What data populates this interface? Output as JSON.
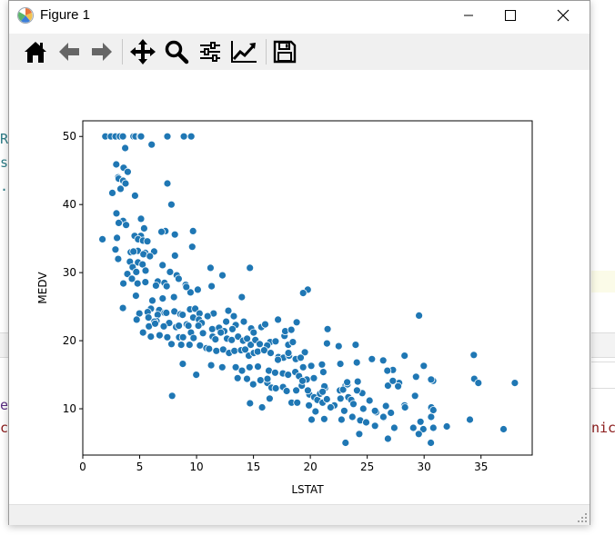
{
  "window": {
    "title": "Figure 1",
    "controls": {
      "minimize": "minimize",
      "maximize": "maximize",
      "close": "close"
    }
  },
  "toolbar": {
    "buttons": [
      {
        "icon": "home-icon",
        "name": "home-button"
      },
      {
        "icon": "back-arrow-icon",
        "name": "back-button"
      },
      {
        "icon": "forward-arrow-icon",
        "name": "forward-button"
      },
      {
        "icon": "pan-icon",
        "name": "pan-button"
      },
      {
        "icon": "zoom-icon",
        "name": "zoom-button"
      },
      {
        "icon": "configure-subplots-icon",
        "name": "subplots-button"
      },
      {
        "icon": "edit-axis-icon",
        "name": "edit-axis-button"
      },
      {
        "icon": "save-icon",
        "name": "save-button"
      }
    ]
  },
  "background": {
    "left_fragments": [
      "R",
      "s",
      "."
    ],
    "left_bottom_fragments": [
      "ex",
      "cu"
    ],
    "right_fragment": "nic",
    "colors": {
      "teal": "#2e7d87",
      "dark_red": "#8b1a1a",
      "purple": "#5a2d82"
    }
  },
  "chart_data": {
    "type": "scatter",
    "xlabel": "LSTAT",
    "ylabel": "MEDV",
    "xlim": [
      0,
      39.5
    ],
    "ylim": [
      3.2,
      52.3
    ],
    "xticks": [
      0,
      5,
      10,
      15,
      20,
      25,
      30,
      35
    ],
    "yticks": [
      10,
      20,
      30,
      40,
      50
    ],
    "grid": false,
    "marker_color": "#1f77b4",
    "marker_edge": "#ffffff",
    "points": [
      [
        1.98,
        50
      ],
      [
        2.47,
        50
      ],
      [
        2.88,
        50
      ],
      [
        3.26,
        50
      ],
      [
        3.53,
        50
      ],
      [
        4.45,
        50
      ],
      [
        4.63,
        50
      ],
      [
        5.04,
        50
      ],
      [
        5.12,
        50
      ],
      [
        7.44,
        50
      ],
      [
        8.88,
        50
      ],
      [
        9.53,
        50
      ],
      [
        6.05,
        48.8
      ],
      [
        3.73,
        48.3
      ],
      [
        2.94,
        45.9
      ],
      [
        3.59,
        45.4
      ],
      [
        3.95,
        44.8
      ],
      [
        3.11,
        44
      ],
      [
        3.16,
        43.8
      ],
      [
        3.55,
        43.5
      ],
      [
        3.76,
        43.1
      ],
      [
        7.44,
        43.1
      ],
      [
        3.32,
        42.3
      ],
      [
        2.6,
        41.7
      ],
      [
        4.59,
        41.3
      ],
      [
        7.79,
        40
      ],
      [
        2.96,
        38.7
      ],
      [
        5.12,
        37.9
      ],
      [
        3.54,
        37.6
      ],
      [
        3.16,
        37.3
      ],
      [
        3.81,
        37
      ],
      [
        5.39,
        36.5
      ],
      [
        7.26,
        36.1
      ],
      [
        9.69,
        36.1
      ],
      [
        6.92,
        36
      ],
      [
        8.09,
        35.6
      ],
      [
        5.1,
        35.4
      ],
      [
        4.56,
        35.4
      ],
      [
        3.01,
        35.1
      ],
      [
        1.73,
        34.9
      ],
      [
        4.86,
        34.9
      ],
      [
        5.29,
        34.7
      ],
      [
        5.68,
        34.6
      ],
      [
        9.62,
        33.8
      ],
      [
        2.87,
        33.4
      ],
      [
        4.84,
        33.2
      ],
      [
        4.21,
        33
      ],
      [
        4.45,
        33.1
      ],
      [
        6.27,
        33.1
      ],
      [
        5.49,
        32.9
      ],
      [
        5.33,
        32.7
      ],
      [
        8.1,
        32.5
      ],
      [
        5.9,
        32.4
      ],
      [
        3.11,
        32
      ],
      [
        4.14,
        31.6
      ],
      [
        4.85,
        31.5
      ],
      [
        5.25,
        31.2
      ],
      [
        7.01,
        31.1
      ],
      [
        4.38,
        30.8
      ],
      [
        11.23,
        30.7
      ],
      [
        14.69,
        30.7
      ],
      [
        5.52,
        30.3
      ],
      [
        4.7,
        30.1
      ],
      [
        7.67,
        30.1
      ],
      [
        3.92,
        29.8
      ],
      [
        8.26,
        29.6
      ],
      [
        12.27,
        29.6
      ],
      [
        8.43,
        29.1
      ],
      [
        4.32,
        29.1
      ],
      [
        6.59,
        28.7
      ],
      [
        5.5,
        28.6
      ],
      [
        7.18,
        28.5
      ],
      [
        4.81,
        28.4
      ],
      [
        9.04,
        28.2
      ],
      [
        3.57,
        28.4
      ],
      [
        6.43,
        28.1
      ],
      [
        7.37,
        28
      ],
      [
        11.32,
        28
      ],
      [
        10.11,
        27.5
      ],
      [
        9.47,
        27.1
      ],
      [
        9.1,
        27.9
      ],
      [
        19.77,
        27.5
      ],
      [
        19.37,
        27
      ],
      [
        4.67,
        26.6
      ],
      [
        7.02,
        26.2
      ],
      [
        8.01,
        26.4
      ],
      [
        13.98,
        26.4
      ],
      [
        6.12,
        25.9
      ],
      [
        5.99,
        24.7
      ],
      [
        6.72,
        24.5
      ],
      [
        5.7,
        24.2
      ],
      [
        7.19,
        24.1
      ],
      [
        4.97,
        24
      ],
      [
        3.53,
        24.8
      ],
      [
        8.05,
        24.3
      ],
      [
        7.34,
        24.1
      ],
      [
        8.58,
        23.9
      ],
      [
        6.58,
        23.8
      ],
      [
        9.43,
        24.6
      ],
      [
        9.88,
        24.7
      ],
      [
        10.26,
        24
      ],
      [
        8.77,
        23.8
      ],
      [
        5.77,
        23.4
      ],
      [
        6.48,
        22.9
      ],
      [
        9.71,
        23.4
      ],
      [
        10.21,
        23.1
      ],
      [
        7.6,
        22.6
      ],
      [
        6.29,
        22.8
      ],
      [
        10.45,
        22.6
      ],
      [
        11.5,
        24
      ],
      [
        12.79,
        24.4
      ],
      [
        13.27,
        23.6
      ],
      [
        10.97,
        23.6
      ],
      [
        4.73,
        23.1
      ],
      [
        5.81,
        22.1
      ],
      [
        6.36,
        22.5
      ],
      [
        7.12,
        22.1
      ],
      [
        8.2,
        22
      ],
      [
        9.14,
        22.4
      ],
      [
        8.44,
        22.2
      ],
      [
        9.28,
        22.2
      ],
      [
        10.16,
        22.2
      ],
      [
        11.38,
        21.7
      ],
      [
        11.98,
        21.9
      ],
      [
        12.6,
        22.8
      ],
      [
        13.44,
        22.3
      ],
      [
        12.43,
        21.4
      ],
      [
        13.15,
        21.7
      ],
      [
        14.15,
        22.8
      ],
      [
        14.8,
        21.8
      ],
      [
        15.02,
        21.2
      ],
      [
        15.7,
        22
      ],
      [
        16.03,
        22.4
      ],
      [
        16.47,
        19.8
      ],
      [
        17.16,
        23.1
      ],
      [
        5.29,
        21.2
      ],
      [
        5.98,
        20.6
      ],
      [
        6.75,
        20.8
      ],
      [
        7.43,
        20.5
      ],
      [
        8.47,
        20.5
      ],
      [
        8.81,
        20.5
      ],
      [
        9.51,
        21.2
      ],
      [
        9.74,
        20.4
      ],
      [
        10.56,
        21.1
      ],
      [
        11.41,
        20.6
      ],
      [
        11.66,
        20.2
      ],
      [
        12.13,
        21.2
      ],
      [
        12.67,
        20.3
      ],
      [
        13.09,
        20.1
      ],
      [
        13.65,
        20.6
      ],
      [
        14.09,
        20
      ],
      [
        14.44,
        20.3
      ],
      [
        14.76,
        19.4
      ],
      [
        15.17,
        20.1
      ],
      [
        15.55,
        19.5
      ],
      [
        16.21,
        19.3
      ],
      [
        16.94,
        19.9
      ],
      [
        17.73,
        20.7
      ],
      [
        18.06,
        19.4
      ],
      [
        18.46,
        19.8
      ],
      [
        19.52,
        18.3
      ],
      [
        7.8,
        19.5
      ],
      [
        8.65,
        19.4
      ],
      [
        9.38,
        19.4
      ],
      [
        10.3,
        19.3
      ],
      [
        10.87,
        18.9
      ],
      [
        11.1,
        18.8
      ],
      [
        11.74,
        18.5
      ],
      [
        12.34,
        18.7
      ],
      [
        12.86,
        18.2
      ],
      [
        13.33,
        18.5
      ],
      [
        13.91,
        18.6
      ],
      [
        14.27,
        18.7
      ],
      [
        14.59,
        17.8
      ],
      [
        15.03,
        18.2
      ],
      [
        15.37,
        18.4
      ],
      [
        15.94,
        18.6
      ],
      [
        16.51,
        18.2
      ],
      [
        17.19,
        17.6
      ],
      [
        17.64,
        17.5
      ],
      [
        18.13,
        17.8
      ],
      [
        18.72,
        17.3
      ],
      [
        19.15,
        17.5
      ],
      [
        8.79,
        16.6
      ],
      [
        11.28,
        16.4
      ],
      [
        12.26,
        16.1
      ],
      [
        13.44,
        16.1
      ],
      [
        13.99,
        15.6
      ],
      [
        14.66,
        16.1
      ],
      [
        15.39,
        16.2
      ],
      [
        16.35,
        15.6
      ],
      [
        16.9,
        15.3
      ],
      [
        17.58,
        15.2
      ],
      [
        18.05,
        15
      ],
      [
        18.68,
        15.4
      ],
      [
        19.01,
        14.8
      ],
      [
        19.69,
        14.3
      ],
      [
        20.31,
        14.5
      ],
      [
        21.14,
        15.4
      ],
      [
        21.32,
        13.1
      ],
      [
        22.6,
        12.7
      ],
      [
        23.09,
        13.4
      ],
      [
        23.29,
        13.8
      ],
      [
        24.16,
        14
      ],
      [
        24.56,
        12.3
      ],
      [
        9.97,
        15
      ],
      [
        13.61,
        14.5
      ],
      [
        14.43,
        14.4
      ],
      [
        14.98,
        13.6
      ],
      [
        15.62,
        14.2
      ],
      [
        16.22,
        13.8
      ],
      [
        16.59,
        13.1
      ],
      [
        17.6,
        13.2
      ],
      [
        17.92,
        12.6
      ],
      [
        18.76,
        12.7
      ],
      [
        19.25,
        13.4
      ],
      [
        19.92,
        12.1
      ],
      [
        20.34,
        11.7
      ],
      [
        20.62,
        11.3
      ],
      [
        21.08,
        10.9
      ],
      [
        21.45,
        11.4
      ],
      [
        22.11,
        10.5
      ],
      [
        22.98,
        9.7
      ],
      [
        23.34,
        11.7
      ],
      [
        23.6,
        11.3
      ],
      [
        24.39,
        8.3
      ],
      [
        25.79,
        9.5
      ],
      [
        26.64,
        10.4
      ],
      [
        7.85,
        11.9
      ],
      [
        14.7,
        10.8
      ],
      [
        15.76,
        10.2
      ],
      [
        16.42,
        11.5
      ],
      [
        18.35,
        10.9
      ],
      [
        19.88,
        10.5
      ],
      [
        20.45,
        9.6
      ],
      [
        21.22,
        8.5
      ],
      [
        22.74,
        8.4
      ],
      [
        23.69,
        8.8
      ],
      [
        24.91,
        8
      ],
      [
        26.45,
        8.7
      ],
      [
        27.38,
        7.2
      ],
      [
        27.8,
        13.8
      ],
      [
        28.28,
        10.5
      ],
      [
        29.2,
        11.9
      ],
      [
        29.68,
        8.1
      ],
      [
        29.93,
        7
      ],
      [
        30.62,
        8.8
      ],
      [
        30.81,
        7.2
      ],
      [
        31.99,
        7.4
      ],
      [
        34.02,
        8.4
      ],
      [
        36.98,
        7
      ],
      [
        37.97,
        13.8
      ],
      [
        22.88,
        12.8
      ],
      [
        23.27,
        13.6
      ],
      [
        24.1,
        12.7
      ],
      [
        25.41,
        17.3
      ],
      [
        25.68,
        9.7
      ],
      [
        26.4,
        17.1
      ],
      [
        26.82,
        13.4
      ],
      [
        27.26,
        15.7
      ],
      [
        27.71,
        13.3
      ],
      [
        28.28,
        17.8
      ],
      [
        28.32,
        10.2
      ],
      [
        29.05,
        7.2
      ],
      [
        29.29,
        14.7
      ],
      [
        29.55,
        23.7
      ],
      [
        29.97,
        16.3
      ],
      [
        30.59,
        5
      ],
      [
        30.63,
        10.2
      ],
      [
        30.79,
        14.1
      ],
      [
        34.37,
        17.9
      ],
      [
        34.41,
        14.4
      ],
      [
        34.77,
        13.8
      ],
      [
        22.49,
        19.2
      ],
      [
        23.24,
        13.9
      ],
      [
        21.52,
        21.7
      ],
      [
        21.46,
        19.6
      ],
      [
        22.64,
        16.6
      ],
      [
        23.98,
        19.4
      ],
      [
        26.77,
        15.6
      ],
      [
        24.08,
        16.8
      ],
      [
        17.79,
        21.4
      ],
      [
        18.33,
        21.6
      ],
      [
        18.8,
        22.7
      ],
      [
        20.08,
        16.3
      ],
      [
        18.07,
        18.2
      ],
      [
        19.37,
        16.1
      ],
      [
        21.24,
        13.3
      ],
      [
        20.85,
        12.2
      ],
      [
        21.02,
        16.5
      ],
      [
        16.96,
        13
      ],
      [
        17.15,
        17.2
      ],
      [
        16.23,
        14.4
      ],
      [
        23.79,
        10.7
      ],
      [
        25.2,
        11.2
      ],
      [
        21.78,
        10.2
      ],
      [
        19.78,
        12.7
      ],
      [
        20.11,
        8.4
      ],
      [
        26.82,
        5.6
      ],
      [
        23.09,
        5
      ],
      [
        24.3,
        6.3
      ],
      [
        29.53,
        6.3
      ],
      [
        27.08,
        9.4
      ],
      [
        25.68,
        7.5
      ],
      [
        24.65,
        10
      ],
      [
        22.65,
        11.5
      ],
      [
        26.42,
        8.8
      ],
      [
        30.62,
        14.3
      ],
      [
        30.81,
        9.8
      ],
      [
        27.25,
        14.1
      ],
      [
        21.08,
        12.5
      ],
      [
        19.31,
        14.1
      ],
      [
        18.85,
        10.9
      ]
    ]
  }
}
